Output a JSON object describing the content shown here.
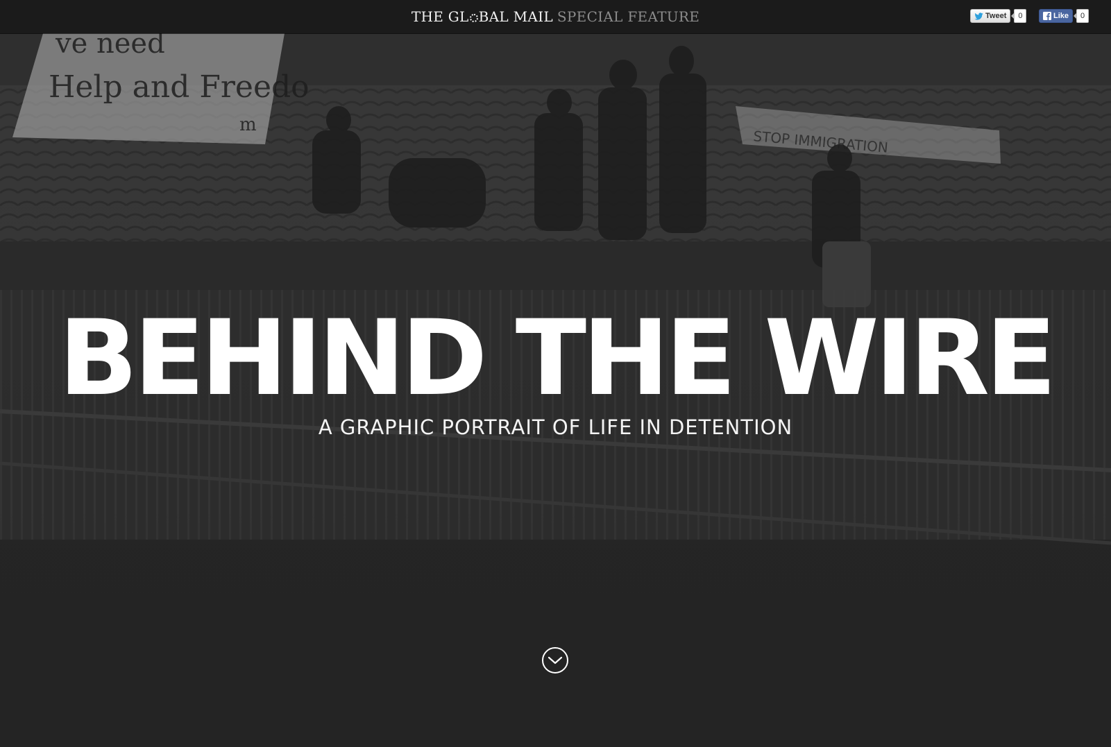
{
  "header": {
    "brand_name": "THE GL◌BAL MAIL",
    "brand_name_parts": [
      "THE GL",
      "BAL MAIL"
    ],
    "feature_label": "SPECIAL FEATURE"
  },
  "social": {
    "tweet_label": "Tweet",
    "tweet_count": "0",
    "like_label": "Like",
    "like_count": "0"
  },
  "hero": {
    "title": "BEHIND THE WIRE",
    "subtitle": "A GRAPHIC PORTRAIT OF LIFE IN DETENTION",
    "banner_left_lines": [
      "ve need",
      "Help and Freedo",
      "m"
    ],
    "banner_right_text": "STOP IMMIGRATION"
  },
  "icons": {
    "scroll": "chevron-down-circle-icon",
    "twitter": "twitter-bird-icon",
    "facebook": "facebook-f-icon"
  },
  "colors": {
    "topbar": "#1b1b1b",
    "background": "#262626",
    "title": "#ffffff",
    "feature_label": "#8c8c8c",
    "like_button": "#4a66a0"
  }
}
